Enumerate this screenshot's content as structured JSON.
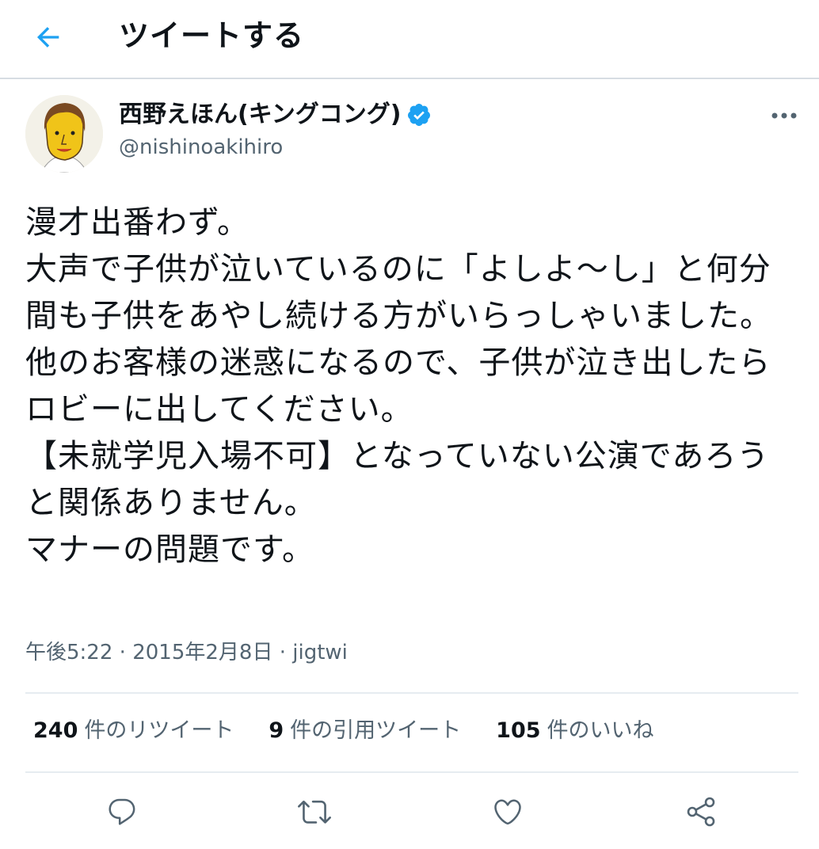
{
  "header": {
    "title": "ツイートする",
    "back_icon": "arrow-left-icon",
    "accent_color": "#1da1f2"
  },
  "author": {
    "display_name": "西野えほん(キングコング)",
    "handle": "@nishinoakihiro",
    "verified": true,
    "verified_color": "#1da1f2"
  },
  "tweet": {
    "text": "漫才出番わず。\n大声で子供が泣いているのに「よしよ〜し」と何分間も子供をあやし続ける方がいらっしゃいました。\n他のお客様の迷惑になるので、子供が泣き出したらロビーに出してください。\n【未就学児入場不可】となっていない公演であろうと関係ありません。\nマナーの問題です。",
    "time": "午後5:22",
    "separator": " · ",
    "date": "2015年2月8日",
    "separator2": " · ",
    "source": "jigtwi"
  },
  "stats": {
    "retweets_count": "240",
    "retweets_label": "件のリツイート",
    "quotes_count": "9",
    "quotes_label": "件の引用ツイート",
    "likes_count": "105",
    "likes_label": "件のいいね"
  },
  "actions": [
    "reply-icon",
    "retweet-icon",
    "like-icon",
    "share-icon"
  ]
}
